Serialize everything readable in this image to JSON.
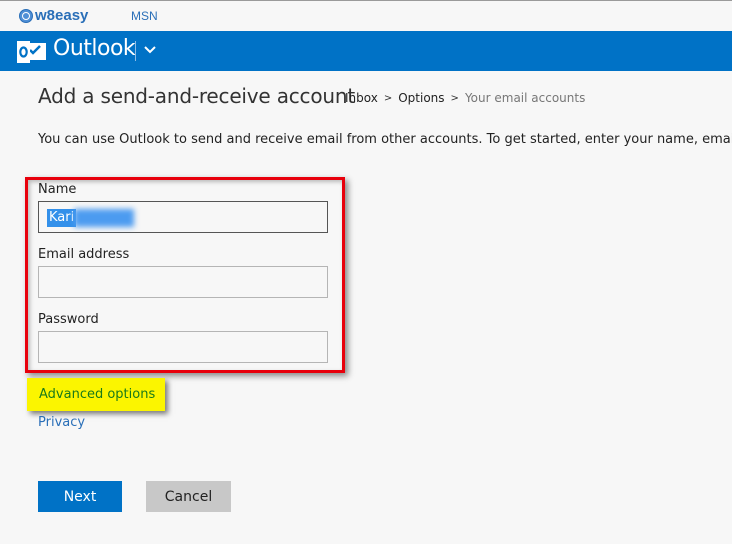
{
  "topbar": {
    "brand": "w8easy",
    "links": [
      "MSN"
    ]
  },
  "header": {
    "app_name": "Outlook",
    "menu_icon": "chevron-down-icon"
  },
  "page": {
    "title": "Add a send-and-receive account",
    "breadcrumb": [
      "Inbox",
      "Options",
      "Your email accounts"
    ],
    "breadcrumb_separator": ">",
    "intro": "You can use Outlook to send and receive email from other accounts. To get started, enter your name, email addre"
  },
  "form": {
    "name": {
      "label": "Name",
      "value": "Kari",
      "value_redacted": true
    },
    "email": {
      "label": "Email address",
      "value": ""
    },
    "password": {
      "label": "Password",
      "value": ""
    }
  },
  "links": {
    "advanced": "Advanced options",
    "privacy": "Privacy"
  },
  "buttons": {
    "next": "Next",
    "cancel": "Cancel"
  },
  "colors": {
    "brand_blue": "#0072c6",
    "annotation_box": "#e8000c",
    "annotation_highlight": "#fbf500"
  }
}
